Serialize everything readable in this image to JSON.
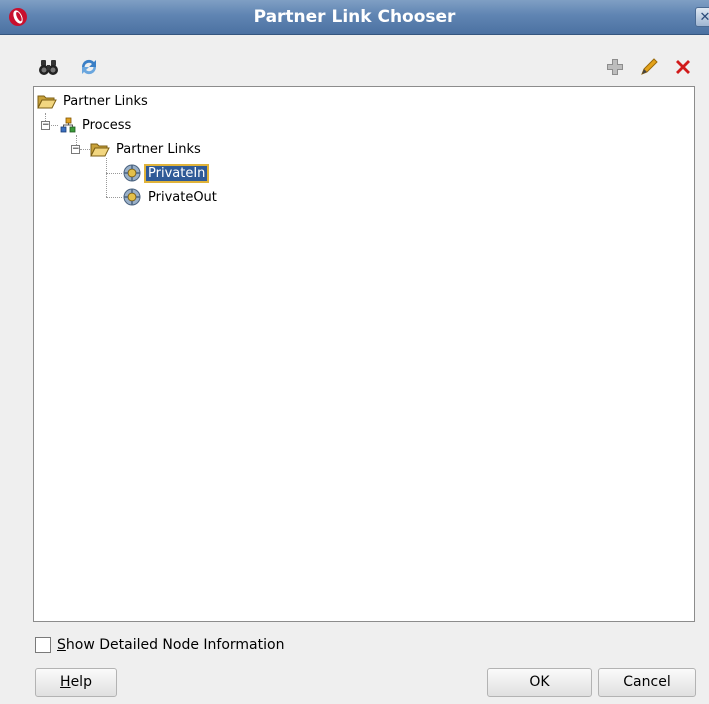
{
  "window": {
    "title": "Partner Link Chooser",
    "close_glyph": "✕"
  },
  "toolbar": {
    "left_icons": [
      "binoculars-icon",
      "refresh-icon"
    ],
    "right_icons": [
      "add-icon",
      "edit-icon",
      "delete-icon"
    ]
  },
  "tree": {
    "root": {
      "label": "Partner Links",
      "icon": "folder-open-icon"
    },
    "process": {
      "label": "Process",
      "icon": "process-icon",
      "expander": "−"
    },
    "partner_links": {
      "label": "Partner Links",
      "icon": "folder-open-icon",
      "expander": "−"
    },
    "items": [
      {
        "label": "PrivateIn",
        "icon": "partner-link-icon",
        "selected": true
      },
      {
        "label": "PrivateOut",
        "icon": "partner-link-icon",
        "selected": false
      }
    ]
  },
  "options": {
    "show_detailed_mnemonic": "S",
    "show_detailed_rest": "how Detailed Node Information",
    "show_detailed_checked": false
  },
  "buttons": {
    "help_mnemonic": "H",
    "help_rest": "elp",
    "ok": "OK",
    "cancel": "Cancel"
  },
  "colors": {
    "title_bar": "#5f84b2",
    "selection": "#2f5a97",
    "selection_outline": "#e0b33a",
    "delete_red": "#d11a1a"
  }
}
